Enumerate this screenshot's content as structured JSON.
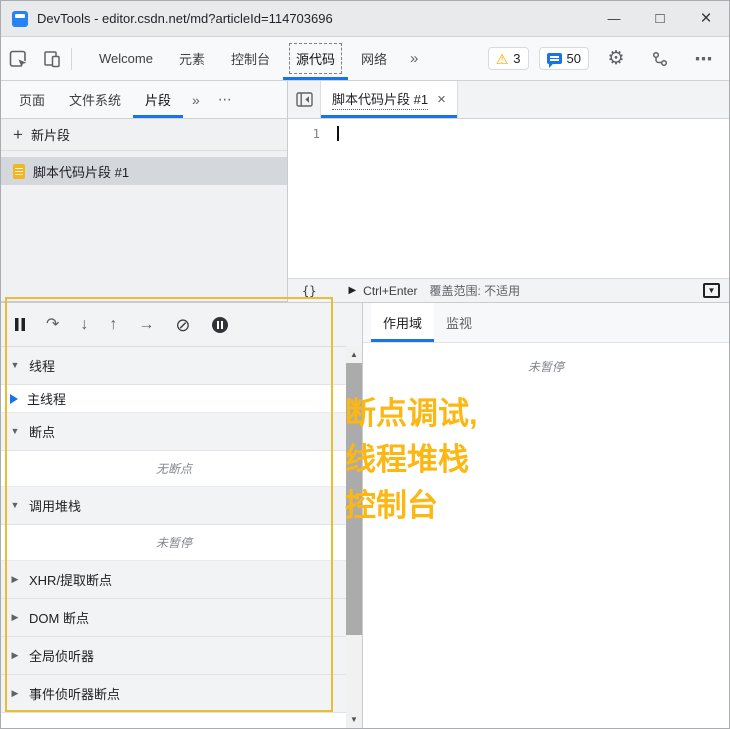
{
  "window": {
    "title": "DevTools - editor.csdn.net/md?articleId=114703696",
    "minimize_icon": "—",
    "maximize_icon": "□",
    "close_icon": "×"
  },
  "toolbar": {
    "tabs": [
      {
        "label": "Welcome"
      },
      {
        "label": "元素"
      },
      {
        "label": "控制台"
      },
      {
        "label": "源代码",
        "active": true
      },
      {
        "label": "网络"
      }
    ],
    "more_tabs_icon": "»",
    "warning_badge": {
      "icon": "⚠",
      "count": "3"
    },
    "message_badge": {
      "count": "50"
    },
    "settings_icon": "⚙",
    "overflow_icon": "⋯"
  },
  "sources_nav": {
    "tabs": [
      {
        "label": "页面"
      },
      {
        "label": "文件系统"
      },
      {
        "label": "片段",
        "active": true
      }
    ],
    "more_tabs_icon": "»",
    "overflow_icon": "⋯"
  },
  "snippets": {
    "plus_icon": "+",
    "new_snippet_label": "新片段",
    "items": [
      {
        "name": "脚本代码片段 #1",
        "selected": true
      }
    ]
  },
  "editor": {
    "tab_title": "脚本代码片段 #1",
    "close_icon": "×",
    "line_number": "1",
    "status": {
      "format_icon": "{}",
      "run_icon": "▶",
      "run_label": "Ctrl+Enter",
      "coverage_label": "覆盖范围: 不适用",
      "drawer_icon": "▼"
    }
  },
  "debug_toolbar": {
    "step_over_icon": "↷",
    "step_into_icon": "↓",
    "step_out_icon": "↑",
    "step_icon": "→",
    "deactivate_breakpoints_icon": "⊘"
  },
  "debugger": {
    "threads": {
      "arrow": "▼",
      "label": "线程"
    },
    "main_thread_label": "主线程",
    "breakpoints": {
      "arrow": "▼",
      "label": "断点"
    },
    "no_breakpoints_label": "无断点",
    "call_stack": {
      "arrow": "▼",
      "label": "调用堆栈"
    },
    "not_paused_label": "未暂停",
    "collapsed_sections": [
      {
        "arrow": "▶",
        "label": "XHR/提取断点"
      },
      {
        "arrow": "▶",
        "label": "DOM 断点"
      },
      {
        "arrow": "▶",
        "label": "全局侦听器"
      },
      {
        "arrow": "▶",
        "label": "事件侦听器断点"
      }
    ]
  },
  "scrollbar": {
    "up_icon": "▲",
    "down_icon": "▼"
  },
  "watch_pane": {
    "tabs": [
      {
        "label": "作用域",
        "active": true
      },
      {
        "label": "监视"
      }
    ],
    "empty_message": "未暂停"
  },
  "annotation": {
    "color": "#fcb713",
    "lines": [
      "断点调试,",
      "线程堆栈",
      "控制台"
    ]
  },
  "colors": {
    "accent": "#1a73e8",
    "warning": "#f9ab00",
    "annotation_border": "#e9be37"
  }
}
